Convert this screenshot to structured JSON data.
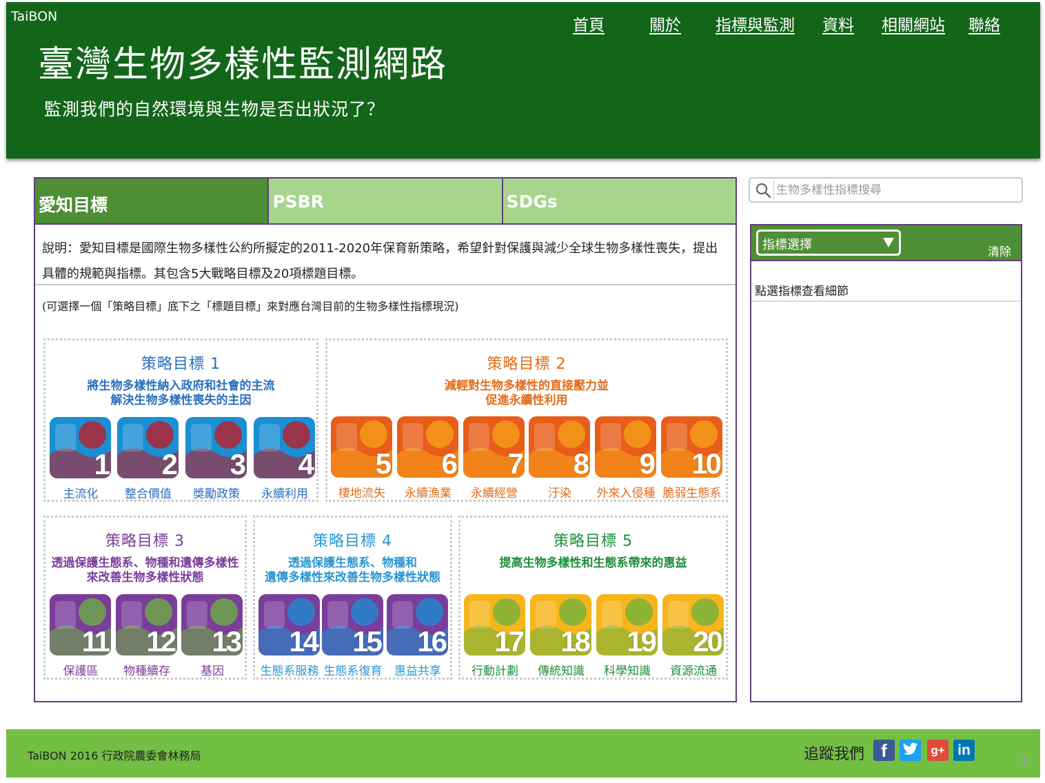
{
  "header": {
    "brand": "TaiBON",
    "title": "臺灣生物多樣性監測網路",
    "subtitle": "監測我們的自然環境與生物是否出狀況了？",
    "nav": [
      "首頁",
      "關於",
      "指標與監測",
      "資料",
      "相關網站",
      "聯絡"
    ]
  },
  "tabs": [
    "愛知目標",
    "PSBR",
    "SDGs"
  ],
  "description": "說明：愛知目標是國際生物多樣性公約所擬定的2011-2020年保育新策略，希望針對保護與減少全球生物多樣性喪失，提出具體的規範與指標。其包含5大戰略目標及20項標題目標。",
  "hint": "(可選擇一個「策略目標」底下之「標題目標」來對應台灣目前的生物多樣性指標現況)",
  "goals": [
    {
      "title": "策略目標 1",
      "desc1": "將生物多樣性納入政府和社會的主流",
      "desc2": "解決生物多樣性喪失的主因"
    },
    {
      "title": "策略目標 2",
      "desc1": "減輕對生物多樣性的直接壓力並",
      "desc2": "促進永續性利用"
    },
    {
      "title": "策略目標 3",
      "desc1": "透過保護生態系、物種和遺傳多樣性",
      "desc2": "來改善生物多樣性狀態"
    },
    {
      "title": "策略目標 4",
      "desc1": "透過保護生態系、物種和",
      "desc2": "遺傳多樣性來改善生物多樣性狀態"
    },
    {
      "title": "策略目標 5",
      "desc1": "提高生物多樣性和生態系帶來的惠益",
      "desc2": ""
    }
  ],
  "targets": [
    {
      "num": "1",
      "label": "主流化",
      "color": "#1a8fd4",
      "accent": "#c4161c"
    },
    {
      "num": "2",
      "label": "整合價值",
      "color": "#1a8fd4",
      "accent": "#c4161c"
    },
    {
      "num": "3",
      "label": "獎勵政策",
      "color": "#1a8fd4",
      "accent": "#c4161c"
    },
    {
      "num": "4",
      "label": "永續利用",
      "color": "#1a8fd4",
      "accent": "#c4161c"
    },
    {
      "num": "5",
      "label": "棲地流失",
      "color": "#e85d1a",
      "accent": "#f7a21b"
    },
    {
      "num": "6",
      "label": "永續漁業",
      "color": "#e85d1a",
      "accent": "#f7a21b"
    },
    {
      "num": "7",
      "label": "永續經營",
      "color": "#e85d1a",
      "accent": "#f7a21b"
    },
    {
      "num": "8",
      "label": "汙染",
      "color": "#e85d1a",
      "accent": "#f7a21b"
    },
    {
      "num": "9",
      "label": "外來入侵種",
      "color": "#e85d1a",
      "accent": "#f7a21b"
    },
    {
      "num": "10",
      "label": "脆弱生態系",
      "color": "#e85d1a",
      "accent": "#f7a21b"
    },
    {
      "num": "11",
      "label": "保護區",
      "color": "#7a3e9a",
      "accent": "#6cb33f"
    },
    {
      "num": "12",
      "label": "物種續存",
      "color": "#7a3e9a",
      "accent": "#6cb33f"
    },
    {
      "num": "13",
      "label": "基因",
      "color": "#7a3e9a",
      "accent": "#6cb33f"
    },
    {
      "num": "14",
      "label": "生態系服務",
      "color": "#7a3e9a",
      "accent": "#1a8fd4"
    },
    {
      "num": "15",
      "label": "生態系復育",
      "color": "#7a3e9a",
      "accent": "#1a8fd4"
    },
    {
      "num": "16",
      "label": "惠益共享",
      "color": "#7a3e9a",
      "accent": "#1a8fd4"
    },
    {
      "num": "17",
      "label": "行動計劃",
      "color": "#f7b51b",
      "accent": "#6cb33f"
    },
    {
      "num": "18",
      "label": "傳統知識",
      "color": "#f7b51b",
      "accent": "#6cb33f"
    },
    {
      "num": "19",
      "label": "科學知識",
      "color": "#f7b51b",
      "accent": "#6cb33f"
    },
    {
      "num": "20",
      "label": "資源流通",
      "color": "#f7b51b",
      "accent": "#6cb33f"
    }
  ],
  "search": {
    "placeholder": "生物多樣性指標搜尋"
  },
  "sidebar": {
    "select_label": "指標選擇",
    "clear_label": "清除",
    "info": "點選指標查看細節"
  },
  "footer": {
    "copyright": "TaiBON 2016 行政院農委會林務局",
    "follow": "追蹤我們",
    "social": [
      "f",
      "t",
      "g+",
      "in"
    ]
  },
  "page_number": "1",
  "colors": {
    "header": "#136619",
    "tab_active": "#4e8e34",
    "tab_inactive": "#a7d58c",
    "footer": "#72bf44",
    "border": "#5d3f7a"
  }
}
